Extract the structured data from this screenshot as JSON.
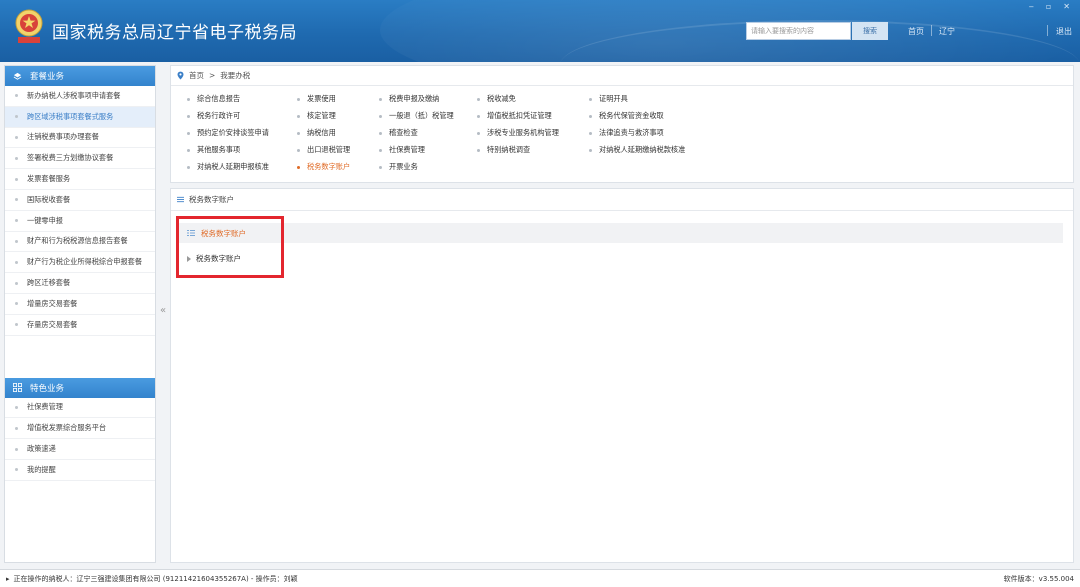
{
  "header": {
    "title": "国家税务总局辽宁省电子税务局",
    "search_placeholder": "请输入要搜索的内容",
    "search_button": "搜索",
    "home_link": "首页",
    "region_link": "辽宁",
    "logout_link": "退出",
    "window_controls": [
      "‒",
      "▫",
      "✕"
    ]
  },
  "sidebar": {
    "section1_title": "套餐业务",
    "section1_items": [
      "新办纳税人涉税事项申请套餐",
      "跨区域涉税事项套餐式服务",
      "注销税费事项办理套餐",
      "签署税费三方划缴协议套餐",
      "发票套餐服务",
      "国际税收套餐",
      "一键零申报",
      "财产和行为税税源信息报告套餐",
      "财产行为税企业所得税综合申报套餐",
      "跨区迁移套餐",
      "增量房交易套餐",
      "存量房交易套餐"
    ],
    "section1_active_index": 1,
    "section2_title": "特色业务",
    "section2_items": [
      "社保费管理",
      "增值税发票综合服务平台",
      "政策速递",
      "我的提醒"
    ],
    "collapse_icon": "«"
  },
  "breadcrumb": {
    "home": "首页",
    "separator": ">",
    "current": "我要办税"
  },
  "nav_grid": {
    "columns": [
      [
        "综合信息报告",
        "税务行政许可",
        "预约定价安排谈签申请",
        "其他服务事项",
        "对纳税人延期申报核准"
      ],
      [
        "发票使用",
        "核定管理",
        "纳税信用",
        "出口退税管理",
        "税务数字账户"
      ],
      [
        "税费申报及缴纳",
        "一般退（抵）税管理",
        "稽查检查",
        "社保费管理",
        "开票业务"
      ],
      [
        "税收减免",
        "增值税抵扣凭证管理",
        "涉税专业服务机构管理",
        "特别纳税调查"
      ],
      [
        "证明开具",
        "税务代保管资金收取",
        "法律追责与救济事项",
        "对纳税人延期缴纳税款核准"
      ]
    ],
    "highlighted": "税务数字账户"
  },
  "content": {
    "panel_title": "税务数字账户",
    "tree_head": "税务数字账户",
    "tree_child": "税务数字账户"
  },
  "footer": {
    "status": "正在操作的纳税人：辽宁三强建设集团有限公司 (91211421604355267A) - 操作员：刘颖",
    "version": "软件版本：v3.55.004"
  },
  "colors": {
    "header_blue": "#1f6ab0",
    "section_blue": "#3383cd",
    "highlight_orange": "#e06b27",
    "annotation_red": "#e3262e"
  }
}
